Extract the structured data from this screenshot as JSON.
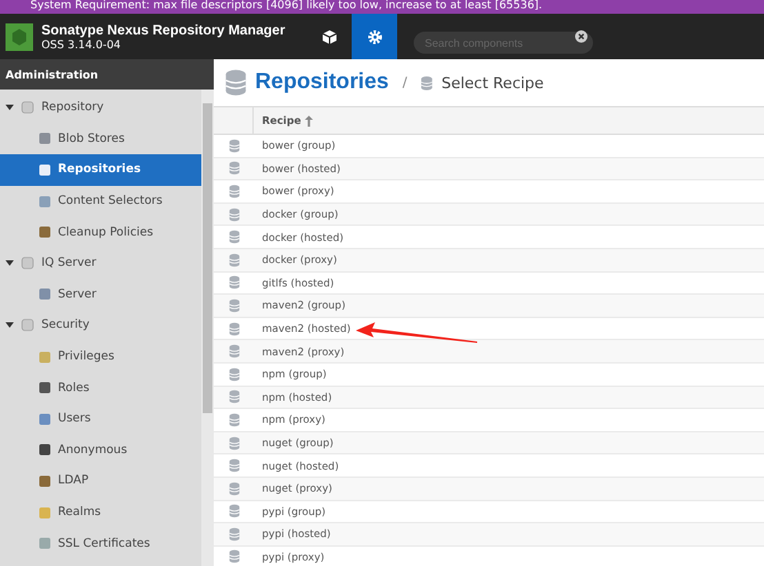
{
  "banner": {
    "text": "System Requirement: max file descriptors [4096] likely too low, increase to at least [65536]."
  },
  "header": {
    "title": "Sonatype Nexus Repository Manager",
    "version": "OSS 3.14.0-04",
    "modes": [
      {
        "kind": "browse",
        "selected": false
      },
      {
        "kind": "admin",
        "selected": true
      }
    ],
    "search": {
      "placeholder": "Search components"
    }
  },
  "sidebar": {
    "title": "Administration",
    "items": [
      {
        "label": "Repository",
        "expanded": true,
        "children": [
          {
            "label": "Blob Stores",
            "selected": false
          },
          {
            "label": "Repositories",
            "selected": true
          },
          {
            "label": "Content Selectors",
            "selected": false
          },
          {
            "label": "Cleanup Policies",
            "selected": false
          }
        ]
      },
      {
        "label": "IQ Server",
        "expanded": true,
        "children": [
          {
            "label": "Server",
            "selected": false
          }
        ]
      },
      {
        "label": "Security",
        "expanded": true,
        "children": [
          {
            "label": "Privileges",
            "selected": false
          },
          {
            "label": "Roles",
            "selected": false
          },
          {
            "label": "Users",
            "selected": false
          },
          {
            "label": "Anonymous",
            "selected": false
          },
          {
            "label": "LDAP",
            "selected": false
          },
          {
            "label": "Realms",
            "selected": false
          },
          {
            "label": "SSL Certificates",
            "selected": false
          }
        ]
      }
    ]
  },
  "page": {
    "title": "Repositories",
    "separator": "/",
    "breadcrumb": "Select Recipe"
  },
  "table": {
    "columns": [
      "Recipe"
    ],
    "rows": [
      "bower (group)",
      "bower (hosted)",
      "bower (proxy)",
      "docker (group)",
      "docker (hosted)",
      "docker (proxy)",
      "gitlfs (hosted)",
      "maven2 (group)",
      "maven2 (hosted)",
      "maven2 (proxy)",
      "npm (group)",
      "npm (hosted)",
      "npm (proxy)",
      "nuget (group)",
      "nuget (hosted)",
      "nuget (proxy)",
      "pypi (group)",
      "pypi (hosted)",
      "pypi (proxy)"
    ]
  }
}
